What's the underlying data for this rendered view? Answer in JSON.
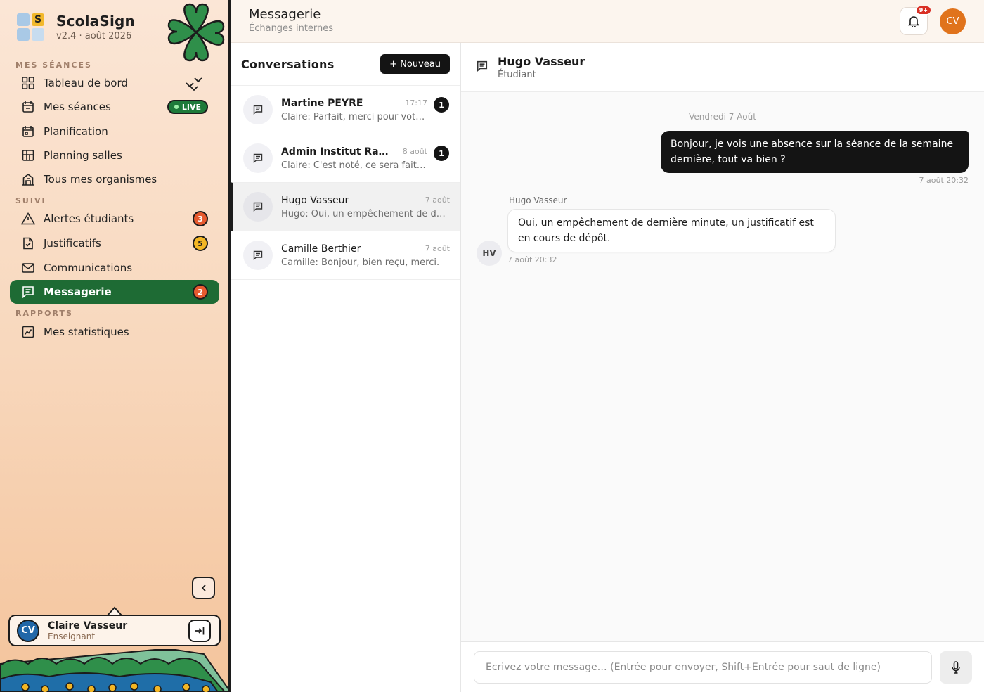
{
  "brand": {
    "name": "ScolaSign",
    "version": "v2.4 · août 2026",
    "logo_letter": "S"
  },
  "sidebar": {
    "sections": [
      {
        "title": "MES SÉANCES"
      },
      {
        "title": "SUIVI"
      },
      {
        "title": "RAPPORTS"
      }
    ],
    "items": [
      {
        "label": "Tableau de bord",
        "icon": "dashboard-icon"
      },
      {
        "label": "Mes séances",
        "icon": "calendar-icon",
        "status": "LIVE"
      },
      {
        "label": "Planification",
        "icon": "calendar-plan-icon"
      },
      {
        "label": "Planning salles",
        "icon": "grid-icon"
      },
      {
        "label": "Tous mes organismes",
        "icon": "building-icon"
      },
      {
        "label": "Alertes étudiants",
        "icon": "alert-icon",
        "badge": "3"
      },
      {
        "label": "Justificatifs",
        "icon": "file-check-icon",
        "badge": "5"
      },
      {
        "label": "Communications",
        "icon": "mail-icon"
      },
      {
        "label": "Messagerie",
        "icon": "message-icon",
        "badge": "2"
      },
      {
        "label": "Mes statistiques",
        "icon": "chart-icon"
      }
    ],
    "user": {
      "initials": "CV",
      "name": "Claire Vasseur",
      "role": "Enseignant"
    }
  },
  "topbar": {
    "title": "Messagerie",
    "subtitle": "Échanges internes",
    "notification_badge": "9+",
    "avatar_initials": "CV"
  },
  "conversations": {
    "title": "Conversations",
    "new_label": "+ Nouveau",
    "items": [
      {
        "name": "Martine PEYRE",
        "date": "17:17",
        "preview": "Claire: Parfait, merci pour votre retour.",
        "unread": "1"
      },
      {
        "name": "Admin Institut Ravel Paris",
        "date": "8 août",
        "preview": "Claire: C'est noté, ce sera fait je pense.",
        "unread": "1"
      },
      {
        "name": "Hugo Vasseur",
        "date": "7 août",
        "preview": "Hugo: Oui, un empêchement de dernière minute.",
        "unread": ""
      },
      {
        "name": "Camille Berthier",
        "date": "7 août",
        "preview": "Camille: Bonjour, bien reçu, merci.",
        "unread": ""
      }
    ]
  },
  "chat": {
    "name": "Hugo Vasseur",
    "role": "Étudiant",
    "day_separator": "Vendredi 7 Août",
    "messages": [
      {
        "direction": "out",
        "text": "Bonjour, je vois une absence sur la séance de la semaine dernière, tout va bien ?",
        "time": "7 août 20:32"
      },
      {
        "direction": "in",
        "author": "Hugo Vasseur",
        "initials": "HV",
        "text": "Oui, un empêchement de dernière minute, un justificatif est en cours de dépôt.",
        "time": "7 août 20:32"
      }
    ],
    "composer_placeholder": "Écrivez votre message… (Entrée pour envoyer, Shift+Entrée pour saut de ligne)"
  },
  "colors": {
    "accent_green": "#1e6b34",
    "badge_red": "#e65a2f",
    "badge_yellow": "#f3b624",
    "avatar_orange": "#e0731c"
  }
}
